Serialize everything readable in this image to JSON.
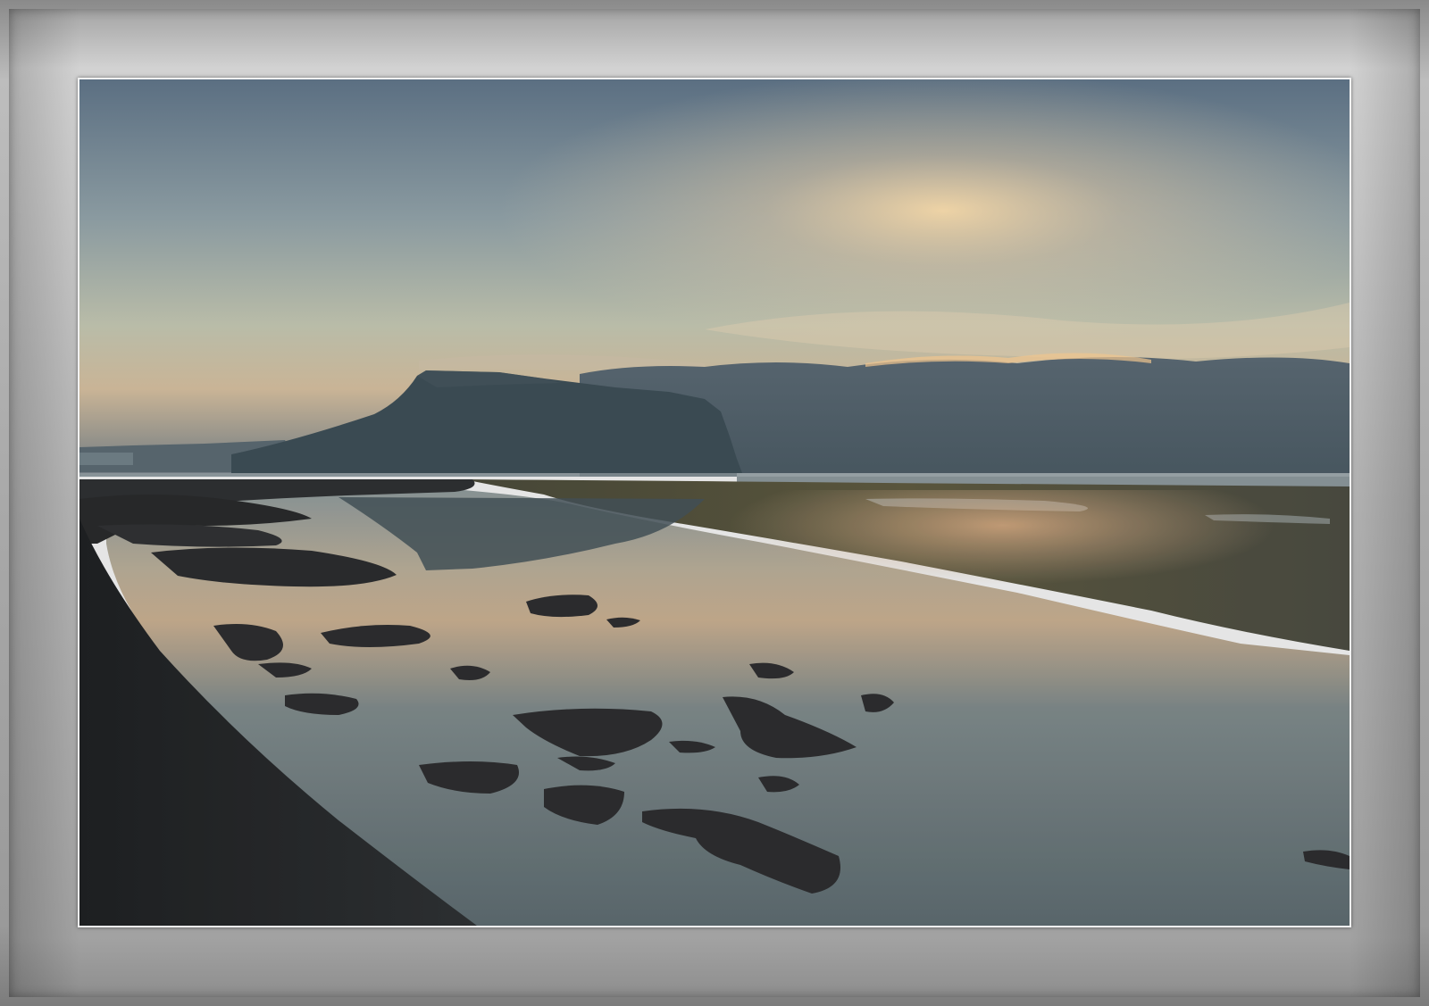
{
  "image": {
    "subject": "",
    "colors": {
      "frame": "#a9a9a9",
      "sky_top": "#5b6f80",
      "sky_mid": "#a6b0a8",
      "sky_glow": "#e9c9a0",
      "cloud_band": "#4b5a66",
      "mountain": "#3a4a52",
      "water": "#7d8a8c",
      "shore": "#2a2c2e",
      "rock": "#2e2e30",
      "seaweed": "#5e5a3c"
    }
  }
}
